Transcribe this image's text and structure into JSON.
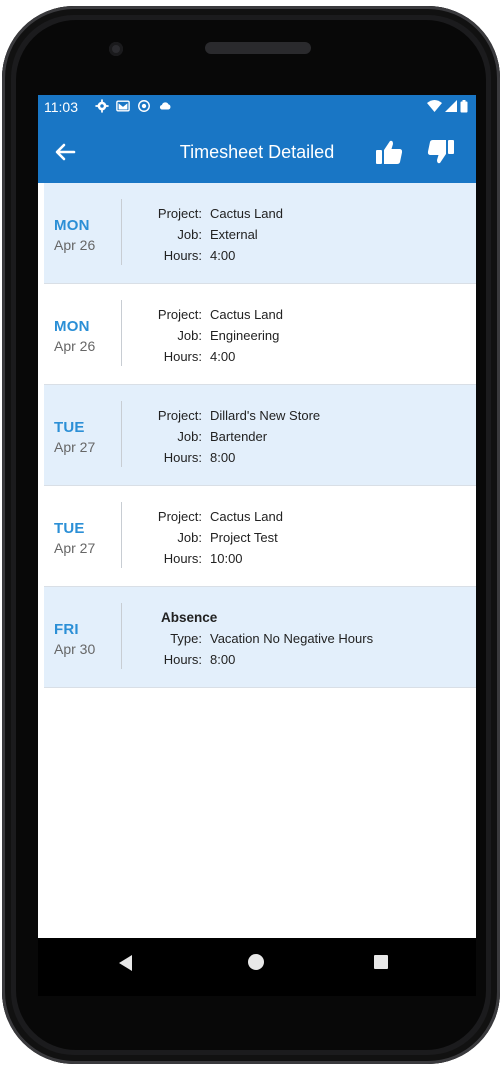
{
  "status_bar": {
    "time": "11:03",
    "icons": [
      "gear-icon",
      "gmail-icon",
      "location-icon",
      "cloud-icon"
    ],
    "right_icons": [
      "wifi-icon",
      "signal-icon",
      "battery-icon"
    ]
  },
  "app_bar": {
    "title": "Timesheet Detailed",
    "back_icon": "arrow-left-icon",
    "approve_icon": "thumbs-up-icon",
    "reject_icon": "thumbs-down-icon",
    "color": "#1976c5"
  },
  "labels": {
    "project": "Project:",
    "job": "Job:",
    "hours": "Hours:",
    "type": "Type:"
  },
  "entries": [
    {
      "dow": "MON",
      "date": "Apr 26",
      "project": "Cactus Land",
      "job": "External",
      "hours": "4:00"
    },
    {
      "dow": "MON",
      "date": "Apr 26",
      "project": "Cactus Land",
      "job": "Engineering",
      "hours": "4:00"
    },
    {
      "dow": "TUE",
      "date": "Apr 27",
      "project": "Dillard's New Store",
      "job": "Bartender",
      "hours": "8:00"
    },
    {
      "dow": "TUE",
      "date": "Apr 27",
      "project": "Cactus Land",
      "job": "Project Test",
      "hours": "10:00"
    },
    {
      "dow": "FRI",
      "date": "Apr 30",
      "absence_title": "Absence",
      "type": "Vacation No Negative Hours",
      "hours": "8:00"
    }
  ],
  "colors": {
    "row_alt": "#e3effb",
    "day_text": "#2b8fd6"
  }
}
